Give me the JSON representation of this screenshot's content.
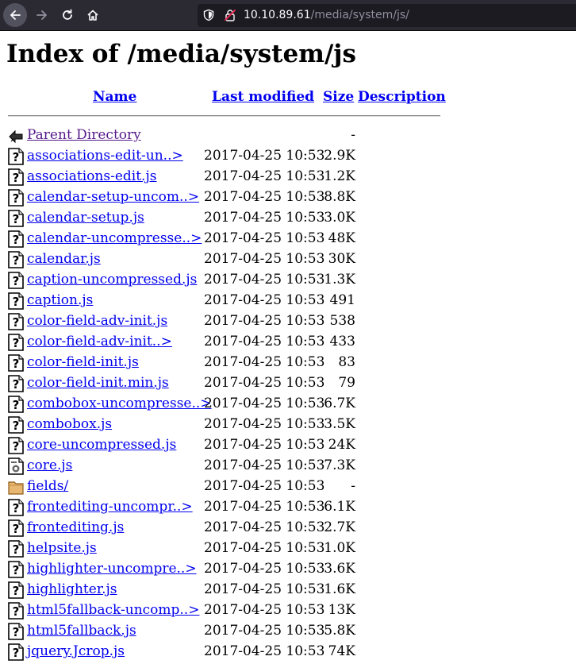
{
  "browser": {
    "url_host": "10.10.89.61",
    "url_path": "/media/system/js/",
    "icons": [
      "back-icon",
      "forward-icon",
      "reload-icon",
      "home-icon",
      "shield-icon",
      "insecure-lock-icon"
    ]
  },
  "page": {
    "title": "Index of /media/system/js",
    "columns": {
      "name": "Name",
      "last_modified": "Last modified",
      "size": "Size",
      "description": "Description"
    },
    "rows": [
      {
        "icon": "back-icon",
        "name": "Parent Directory",
        "date": "",
        "size": "-",
        "visited": true
      },
      {
        "icon": "unknown-file-icon",
        "name": "associations-edit-un..>",
        "date": "2017-04-25 10:53",
        "size": "2.9K"
      },
      {
        "icon": "unknown-file-icon",
        "name": "associations-edit.js",
        "date": "2017-04-25 10:53",
        "size": "1.2K"
      },
      {
        "icon": "unknown-file-icon",
        "name": "calendar-setup-uncom..>",
        "date": "2017-04-25 10:53",
        "size": "8.8K"
      },
      {
        "icon": "unknown-file-icon",
        "name": "calendar-setup.js",
        "date": "2017-04-25 10:53",
        "size": "3.0K"
      },
      {
        "icon": "unknown-file-icon",
        "name": "calendar-uncompresse..>",
        "date": "2017-04-25 10:53",
        "size": "48K"
      },
      {
        "icon": "unknown-file-icon",
        "name": "calendar.js",
        "date": "2017-04-25 10:53",
        "size": "30K"
      },
      {
        "icon": "unknown-file-icon",
        "name": "caption-uncompressed.js",
        "date": "2017-04-25 10:53",
        "size": "1.3K"
      },
      {
        "icon": "unknown-file-icon",
        "name": "caption.js",
        "date": "2017-04-25 10:53",
        "size": "491"
      },
      {
        "icon": "unknown-file-icon",
        "name": "color-field-adv-init.js",
        "date": "2017-04-25 10:53",
        "size": "538"
      },
      {
        "icon": "unknown-file-icon",
        "name": "color-field-adv-init..>",
        "date": "2017-04-25 10:53",
        "size": "433"
      },
      {
        "icon": "unknown-file-icon",
        "name": "color-field-init.js",
        "date": "2017-04-25 10:53",
        "size": "83"
      },
      {
        "icon": "unknown-file-icon",
        "name": "color-field-init.min.js",
        "date": "2017-04-25 10:53",
        "size": "79"
      },
      {
        "icon": "unknown-file-icon",
        "name": "combobox-uncompresse..>",
        "date": "2017-04-25 10:53",
        "size": "6.7K"
      },
      {
        "icon": "unknown-file-icon",
        "name": "combobox.js",
        "date": "2017-04-25 10:53",
        "size": "3.5K"
      },
      {
        "icon": "unknown-file-icon",
        "name": "core-uncompressed.js",
        "date": "2017-04-25 10:53",
        "size": "24K"
      },
      {
        "icon": "script-file-icon",
        "name": "core.js",
        "date": "2017-04-25 10:53",
        "size": "7.3K"
      },
      {
        "icon": "folder-icon",
        "name": "fields/",
        "date": "2017-04-25 10:53",
        "size": "-"
      },
      {
        "icon": "unknown-file-icon",
        "name": "frontediting-uncompr..>",
        "date": "2017-04-25 10:53",
        "size": "6.1K"
      },
      {
        "icon": "unknown-file-icon",
        "name": "frontediting.js",
        "date": "2017-04-25 10:53",
        "size": "2.7K"
      },
      {
        "icon": "unknown-file-icon",
        "name": "helpsite.js",
        "date": "2017-04-25 10:53",
        "size": "1.0K"
      },
      {
        "icon": "unknown-file-icon",
        "name": "highlighter-uncompre..>",
        "date": "2017-04-25 10:53",
        "size": "3.6K"
      },
      {
        "icon": "unknown-file-icon",
        "name": "highlighter.js",
        "date": "2017-04-25 10:53",
        "size": "1.6K"
      },
      {
        "icon": "unknown-file-icon",
        "name": "html5fallback-uncomp..>",
        "date": "2017-04-25 10:53",
        "size": "13K"
      },
      {
        "icon": "unknown-file-icon",
        "name": "html5fallback.js",
        "date": "2017-04-25 10:53",
        "size": "5.8K"
      },
      {
        "icon": "unknown-file-icon",
        "name": "jquery.Jcrop.js",
        "date": "2017-04-25 10:53",
        "size": "74K"
      }
    ]
  }
}
